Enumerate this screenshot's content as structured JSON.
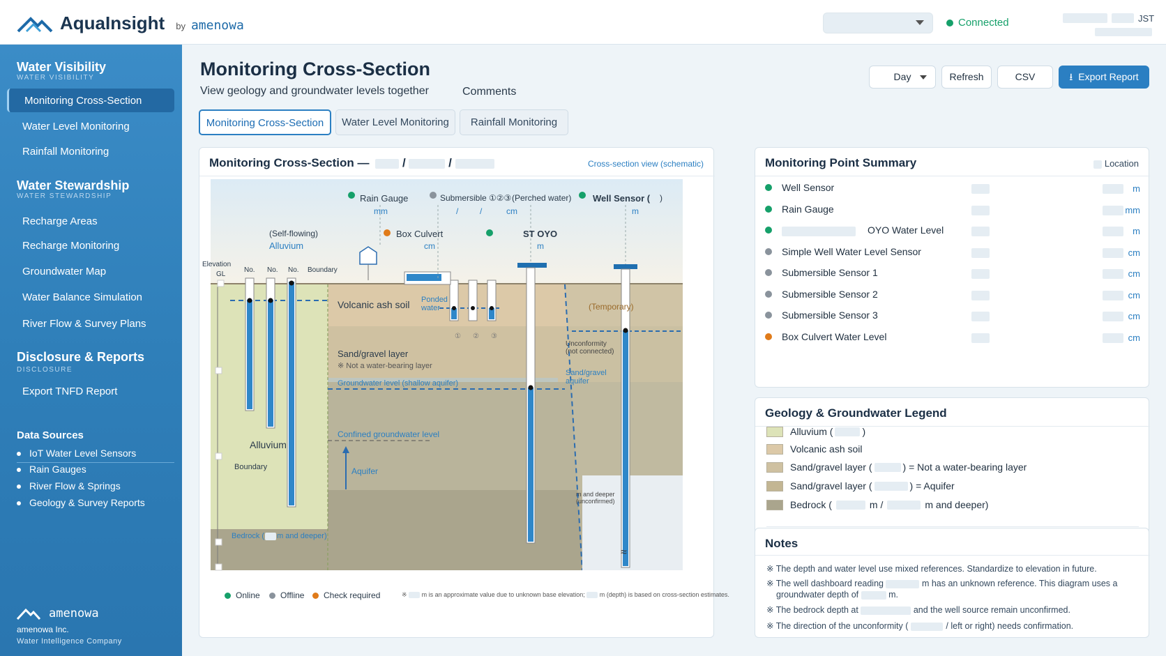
{
  "header": {
    "brand": "AquaInsight",
    "by": "by",
    "maker": "amenowa",
    "status": "Connected",
    "tz": "JST"
  },
  "sidebar": {
    "sec1": "Water Visibility",
    "sec1_sub": "WATER VISIBILITY",
    "nav1": [
      "Monitoring Cross-Section",
      "Water Level Monitoring",
      "Rainfall Monitoring"
    ],
    "sec2": "Water Stewardship",
    "sec2_sub": "WATER STEWARDSHIP",
    "nav2": [
      "Recharge Areas",
      "Recharge Monitoring",
      "Groundwater Map",
      "Water Balance Simulation",
      "River Flow & Survey Plans"
    ],
    "sec3": "Disclosure & Reports",
    "sec3_sub": "DISCLOSURE",
    "nav3": [
      "Export TNFD Report"
    ],
    "sources_title": "Data Sources",
    "sources": [
      "IoT Water Level Sensors",
      "Rain Gauges",
      "River Flow & Springs",
      "Geology & Survey Reports"
    ],
    "footer_logo": "amenowa",
    "footer_company": "amenowa Inc.",
    "footer_tag": "Water Intelligence Company"
  },
  "main": {
    "title": "Monitoring Cross-Section",
    "subtitle": "View geology and groundwater levels together",
    "comments": "Comments",
    "period": "Day",
    "refresh": "Refresh",
    "csv": "CSV",
    "export": "Export Report",
    "tabs": [
      "Monitoring Cross-Section",
      "Water Level Monitoring",
      "Rainfall Monitoring"
    ]
  },
  "cross": {
    "title": "Monitoring Cross-Section —",
    "sep": "/",
    "view": "Cross-section view (schematic)",
    "rain": "Rain Gauge",
    "mm": "mm",
    "sub": "Submersible ①②③",
    "perched": "(Perched water)",
    "cm": "cm",
    "well": "Well Sensor (",
    "paren_close": ")",
    "m": "m",
    "selfflow": "(Self-flowing)",
    "alluvium_top": "Alluvium",
    "culvert": "Box Culvert",
    "st": "ST OYO",
    "elev": "Elevation",
    "gl": "GL",
    "no": "No.",
    "boundary": "Boundary",
    "volcanic": "Volcanic ash soil",
    "ponded": "Ponded water",
    "temporary": "(Temporary)",
    "sand": "Sand/gravel layer",
    "notwb": "※ Not a water-bearing layer",
    "gw_shallow": "Groundwater level (shallow aquifer)",
    "unconf": "Unconformity (not connected)",
    "sandaq": "Sand/gravel aquifer",
    "confined": "Confined groundwater level",
    "aquifer": "Aquifer",
    "alluvium": "Alluvium",
    "boundary2": "Boundary",
    "deeper": "m and deeper (unconfirmed)",
    "bedrock": "Bedrock (",
    "bedrock2": "m and deeper)",
    "c1": "①",
    "c2": "②",
    "c3": "③",
    "leg_online": "Online",
    "leg_offline": "Offline",
    "leg_check": "Check required",
    "fn": "※",
    "fn_note": "m is an approximate value due to unknown base elevation;",
    "fn_note2": "m (depth) is based on cross-section estimates."
  },
  "summary": {
    "title": "Monitoring Point Summary",
    "loc": "Location",
    "items": [
      {
        "label": "Well Sensor",
        "unit": "m",
        "color": "#16a06a"
      },
      {
        "label": "Rain Gauge",
        "unit": "mm",
        "color": "#16a06a"
      },
      {
        "label": "OYO Water Level",
        "unit": "m",
        "color": "#16a06a"
      },
      {
        "label": "Simple Well Water Level Sensor",
        "unit": "cm",
        "color": "#8a939c"
      },
      {
        "label": "Submersible Sensor 1",
        "unit": "cm",
        "color": "#8a939c"
      },
      {
        "label": "Submersible Sensor 2",
        "unit": "cm",
        "color": "#8a939c"
      },
      {
        "label": "Submersible Sensor 3",
        "unit": "cm",
        "color": "#8a939c"
      },
      {
        "label": "Box Culvert Water Level",
        "unit": "cm",
        "color": "#e07b1a"
      }
    ]
  },
  "legend": {
    "title": "Geology & Groundwater Legend",
    "i1a": "Alluvium (",
    "i1b": ")",
    "i2": "Volcanic ash soil",
    "i3a": "Sand/gravel layer (",
    "i3b": ") = Not a water-bearing layer",
    "i4a": "Sand/gravel layer (",
    "i4b": ") = Aquifer",
    "i5a": "Bedrock (",
    "i5b": "m /",
    "i5c": "m and deeper)"
  },
  "notes": {
    "title": "Notes",
    "n1": "※ The depth and water level use mixed references.  Standardize to elevation in future.",
    "n2a": "※ The well dashboard reading",
    "n2b": "m has an unknown reference. This diagram uses a",
    "n2c": "groundwater depth of",
    "n2d": "m.",
    "n3a": "※ The bedrock depth at",
    "n3b": "and the well source remain unconfirmed.",
    "n4a": "※ The direction of the unconformity (",
    "n4b": "/  left or right) needs confirmation."
  }
}
